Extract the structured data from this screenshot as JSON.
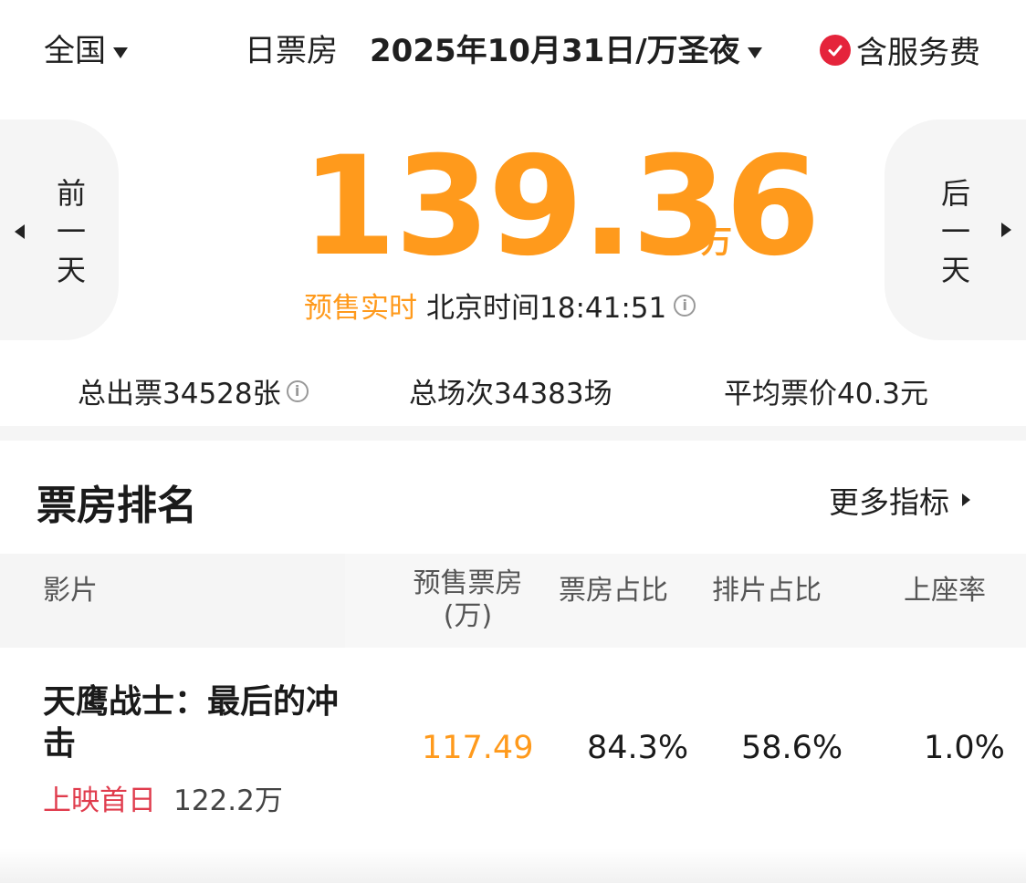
{
  "header": {
    "region": "全国",
    "mode": "日票房",
    "date": "2025年10月31日/万圣夜",
    "service_fee": "含服务费"
  },
  "nav": {
    "prev_chars": [
      "前",
      "一",
      "天"
    ],
    "next_chars": [
      "后",
      "一",
      "天"
    ]
  },
  "summary": {
    "box_office": "139.36",
    "unit": "万",
    "presale_label": "预售实时",
    "time_label": "北京时间18:41:51"
  },
  "stats": {
    "tickets": "总出票34528张",
    "sessions": "总场次34383场",
    "avg_price": "平均票价40.3元"
  },
  "ranking": {
    "title": "票房排名",
    "more": "更多指标",
    "columns": {
      "film": "影片",
      "presale_line1": "预售票房",
      "presale_line2": "(万)",
      "share": "票房占比",
      "schedule": "排片占比",
      "occupancy": "上座率"
    },
    "rows": [
      {
        "title": "天鹰战士：最后的冲击",
        "tag": "上映首日",
        "total": "122.2万",
        "presale": "117.49",
        "share": "84.3%",
        "schedule": "58.6%",
        "occupancy": "1.0%"
      }
    ]
  },
  "colors": {
    "accent": "#ff9a1c",
    "badge_red": "#e5243b",
    "tag_red": "#e03c4d",
    "panel_gray": "#f5f5f5"
  }
}
